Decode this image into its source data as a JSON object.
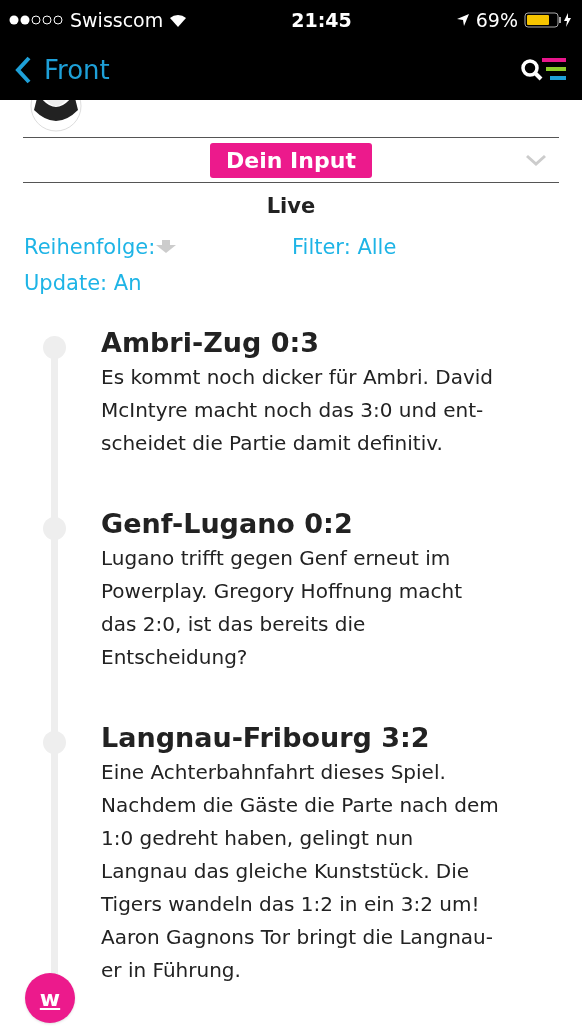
{
  "status_bar": {
    "carrier": "Swisscom",
    "time": "21:45",
    "battery": "69%"
  },
  "nav": {
    "back": "Front"
  },
  "input_button": "Dein Input",
  "section_title": "Live",
  "controls": [
    {
      "kind": "sort",
      "label": "Reihenfolge:"
    },
    {
      "kind": "text",
      "label": "Filter: Alle"
    },
    {
      "kind": "text",
      "label": "Update: An"
    }
  ],
  "entries": [
    {
      "title": "Ambri-Zug 0:3",
      "lines": [
        "Es kommt noch dicker für Ambri. David",
        "McIntyre macht noch das 3:0 und ent-",
        "scheidet die Partie damit definitiv."
      ]
    },
    {
      "title": "Genf-Lugano 0:2",
      "lines": [
        "Lugano trifft gegen Genf erneut im",
        "Powerplay. Gregory Hoffnung macht",
        "das 2:0, ist das bereits die",
        "Entscheidung?"
      ]
    },
    {
      "title": "Langnau-Fribourg 3:2",
      "lines": [
        "Eine Achterbahnfahrt dieses Spiel.",
        "Nachdem die Gäste die Parte nach dem",
        "1:0 gedreht haben, gelingt nun",
        "Langnau das gleiche Kunststück. Die",
        "Tigers wandeln das 1:2 in ein 3:2 um!",
        "Aaron Gagnons Tor bringt die Langnau-",
        "er in Führung."
      ]
    }
  ],
  "fab": "w"
}
